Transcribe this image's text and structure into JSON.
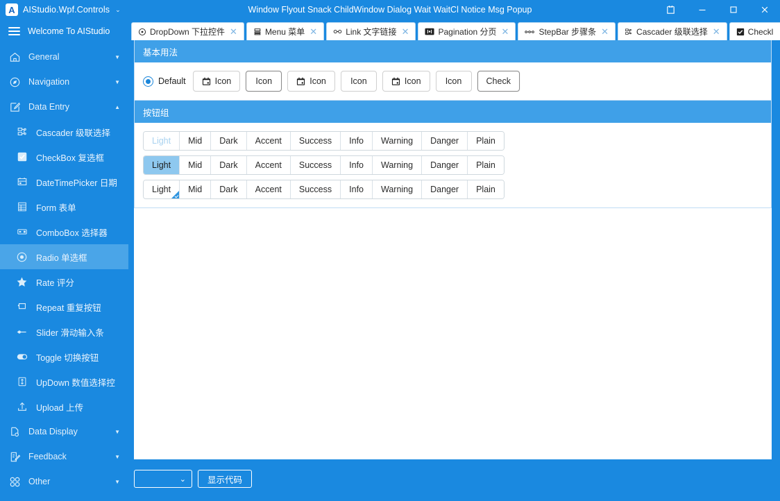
{
  "window": {
    "app_title": "AIStudio.Wpf.Controls",
    "app_logo_letter": "A",
    "title_center": "Window Flyout Snack ChildWindow Dialog Wait WaitCl Notice Msg Popup",
    "theme_icon": "shirt-icon",
    "minimize": "–",
    "maximize": "☐",
    "close": "✕",
    "brand_caret": "⌄"
  },
  "sidebar": {
    "welcome": "Welcome To AIStudio",
    "hamburger": "menu-icon",
    "groups": [
      {
        "label": "General",
        "icon": "home-icon",
        "expanded": false,
        "caret": "▼"
      },
      {
        "label": "Navigation",
        "icon": "compass-icon",
        "expanded": false,
        "caret": "▼"
      },
      {
        "label": "Data Entry",
        "icon": "edit-square-icon",
        "expanded": true,
        "caret": "▲"
      }
    ],
    "items": [
      {
        "label": "Cascader 级联选择",
        "icon": "cascader-icon",
        "active": false
      },
      {
        "label": "CheckBox 复选框",
        "icon": "checkbox-icon",
        "active": false
      },
      {
        "label": "DateTimePicker 日期",
        "icon": "calendar-icon",
        "active": false
      },
      {
        "label": "Form 表单",
        "icon": "form-icon",
        "active": false
      },
      {
        "label": "ComboBox 选择器",
        "icon": "combobox-icon",
        "active": false
      },
      {
        "label": "Radio 单选框",
        "icon": "radio-icon",
        "active": true
      },
      {
        "label": "Rate 评分",
        "icon": "star-icon",
        "active": false
      },
      {
        "label": "Repeat 重复按钮",
        "icon": "repeat-icon",
        "active": false
      },
      {
        "label": "Slider 滑动输入条",
        "icon": "slider-icon",
        "active": false
      },
      {
        "label": "Toggle 切换按钮",
        "icon": "toggle-icon",
        "active": false
      },
      {
        "label": "UpDown 数值选择控",
        "icon": "updown-icon",
        "active": false
      },
      {
        "label": "Upload 上传",
        "icon": "upload-icon",
        "active": false
      }
    ],
    "groups_bottom": [
      {
        "label": "Data Display",
        "icon": "document-search-icon",
        "caret": "▼"
      },
      {
        "label": "Feedback",
        "icon": "note-edit-icon",
        "caret": "▼"
      },
      {
        "label": "Other",
        "icon": "grid-icon",
        "caret": "▼"
      }
    ]
  },
  "tabs": [
    {
      "label": "DropDown 下拉控件",
      "icon": "dropdown-icon",
      "close": "✕",
      "active": true
    },
    {
      "label": "Menu 菜单",
      "icon": "menu-list-icon",
      "close": "✕",
      "active": false
    },
    {
      "label": "Link 文字链接",
      "icon": "link-icon",
      "close": "✕",
      "active": false
    },
    {
      "label": "Pagination 分页",
      "icon": "pagination-icon",
      "close": "✕",
      "active": false
    },
    {
      "label": "StepBar 步骤条",
      "icon": "stepbar-icon",
      "close": "✕",
      "active": false
    },
    {
      "label": "Cascader 级联选择",
      "icon": "cascader-icon",
      "close": "✕",
      "active": false
    },
    {
      "label": "Checkl",
      "icon": "checkbox-filled-icon",
      "caret": "⌄",
      "active": false,
      "truncated": true
    }
  ],
  "main": {
    "basic": {
      "title": "基本用法",
      "radio_label": "Default",
      "buttons": [
        {
          "label": "Icon",
          "icon": true,
          "hover": false
        },
        {
          "label": "Icon",
          "icon": false,
          "hover": true
        },
        {
          "label": "Icon",
          "icon": true,
          "hover": false
        },
        {
          "label": "Icon",
          "icon": false,
          "hover": false
        },
        {
          "label": "Icon",
          "icon": true,
          "hover": false
        },
        {
          "label": "Icon",
          "icon": false,
          "hover": false
        },
        {
          "label": "Check",
          "icon": false,
          "hover": true
        }
      ]
    },
    "group": {
      "title": "按钮组",
      "labels": [
        "Light",
        "Mid",
        "Dark",
        "Accent",
        "Success",
        "Info",
        "Warning",
        "Danger",
        "Plain"
      ],
      "rows": [
        {
          "state": "disabled",
          "selected_index": 0
        },
        {
          "state": "selected",
          "selected_index": 0
        },
        {
          "state": "corner-checked",
          "selected_index": 0
        }
      ]
    }
  },
  "bottom": {
    "combo_value": "",
    "combo_caret": "⌄",
    "show_code": "显示代码"
  },
  "colors": {
    "brand_blue": "#1a89e0",
    "header_blue": "#3fa0e8",
    "active_item": "#4aa5e8",
    "selected_group_btn": "#8ec8ef",
    "disabled_text": "#a9d2f0",
    "panel_border": "#bfdcf4"
  }
}
